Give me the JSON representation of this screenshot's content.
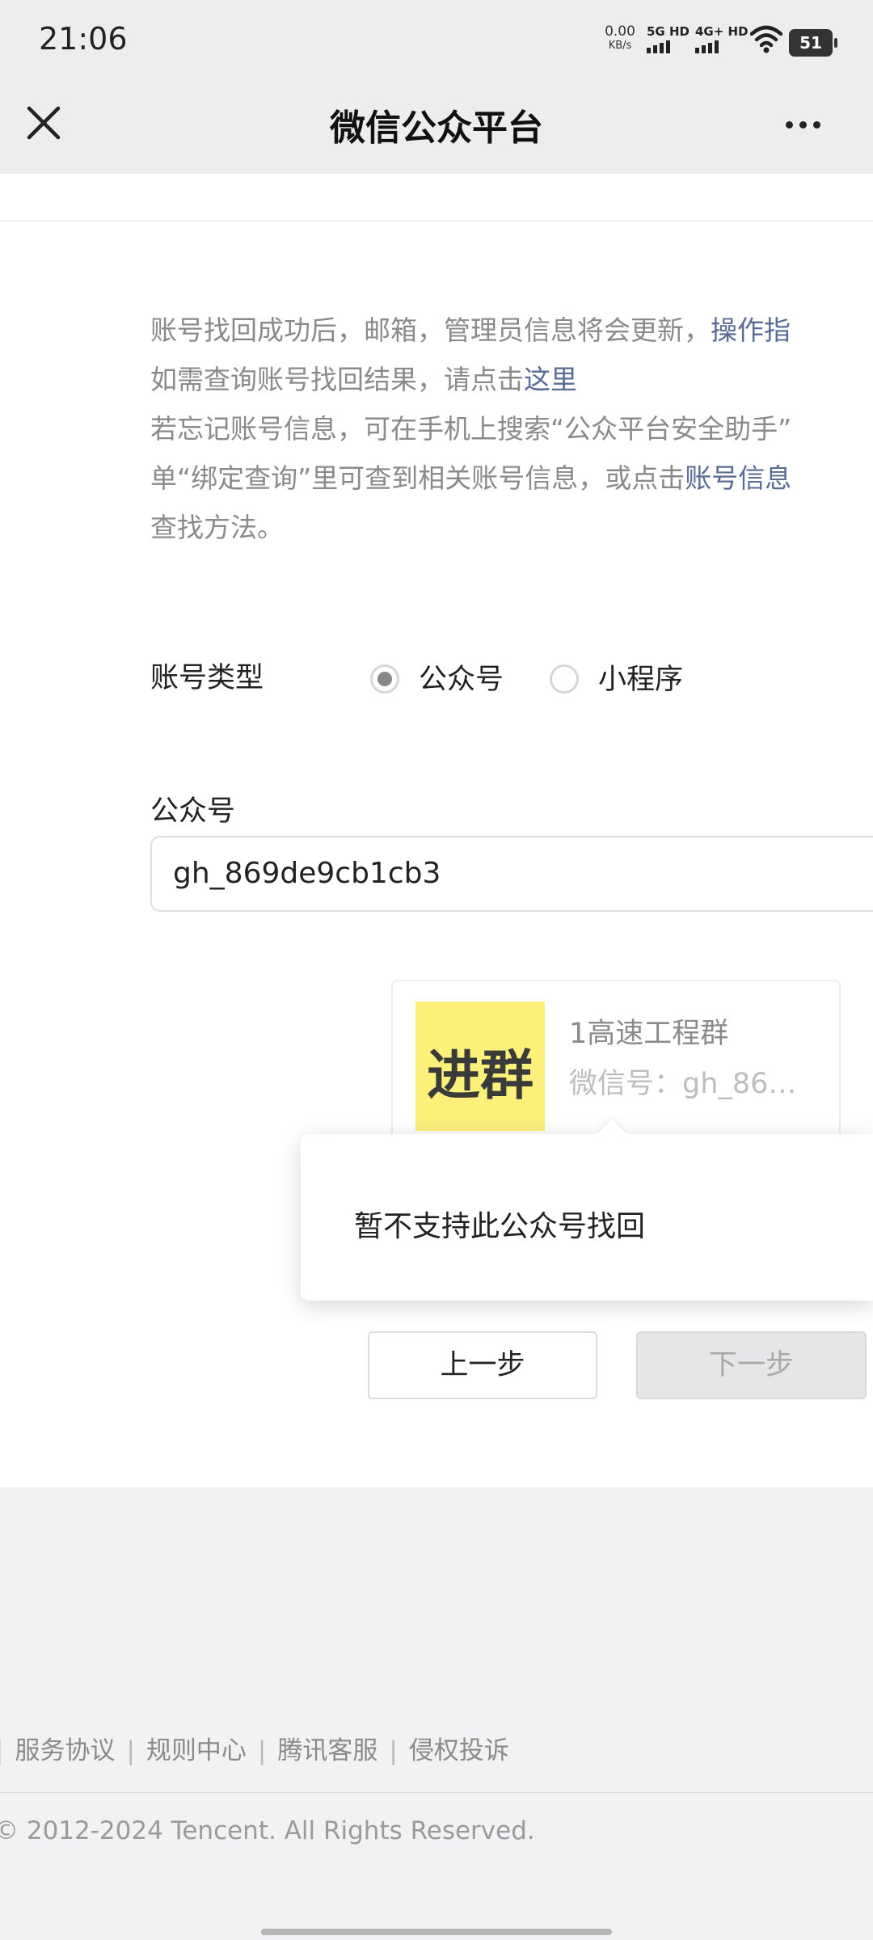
{
  "status_bar": {
    "time": "21:06",
    "net_speed_value": "0.00",
    "net_speed_unit": "KB/s",
    "sim1": "5G HD",
    "sim2": "4G+ HD",
    "battery": "51"
  },
  "nav": {
    "title": "微信公众平台"
  },
  "info": {
    "line1_text": "账号找回成功后，邮箱，管理员信息将会更新，",
    "line1_link": "操作指",
    "line2_text": "如需查询账号找回结果，请点击",
    "line2_link": "这里",
    "line3_text": "若忘记账号信息，可在手机上搜索“公众平台安全助手”",
    "line4_text": "单“绑定查询”里可查到相关账号信息，或点击",
    "line4_link": "账号信息",
    "line5_text": "查找方法。"
  },
  "form": {
    "type_label": "账号类型",
    "options": [
      {
        "label": "公众号",
        "selected": true
      },
      {
        "label": "小程序",
        "selected": false
      }
    ],
    "field_label": "公众号",
    "field_value": "gh_869de9cb1cb3"
  },
  "account_card": {
    "logo_text": "进群",
    "logo_color": "#fbf07a",
    "name": "1高速工程群",
    "wechat_id": "微信号：gh_86…"
  },
  "popup": {
    "message": "暂不支持此公众号找回"
  },
  "buttons": {
    "prev": "上一步",
    "next": "下一步"
  },
  "footer": {
    "links": [
      "服务协议",
      "规则中心",
      "腾讯客服",
      "侵权投诉"
    ],
    "separator": "|",
    "copyright": "© 2012-2024 Tencent. All Rights Reserved."
  },
  "colors": {
    "link": "#576b95",
    "header_bg": "#ededed",
    "page_bg": "#f2f2f4"
  }
}
